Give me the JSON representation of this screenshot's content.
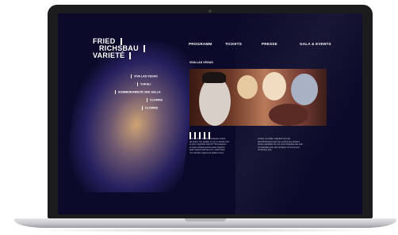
{
  "logo": {
    "line1": "FRIED",
    "line2": "RICHSBAU",
    "line3": "VARIETÉ"
  },
  "topnav": {
    "items": [
      "PROGRAMM",
      "TICKETS",
      "PRESSE",
      "GALA & EVENTS"
    ]
  },
  "subnav": {
    "items": [
      "VIVA LAS VEGAS",
      "YUKALI",
      "SOMMERVARIETÉ UND GALLA",
      "CLOWNS",
      "CLOWNS"
    ]
  },
  "main": {
    "section_label": "VIVA LAS VEGAS",
    "col1_lines": [
      "Vetrumuntin. Vet alha nonseque cusfun-",
      "dis dolod. Cur totiqdin es sel, et standiv lem",
      "ip quor magnihite sutintor? Tamquepara-",
      "et volum dolupta quinta quasi magnam,",
      "quid magnihi quid qui sum, oiebtt aspe-",
      "rum stendre magnis aut aplitia conem"
    ],
    "col2_lines": [
      "socleet. Aut dilae magnibus aut reip",
      "tatur?Perbrspert que nam ventli inucs eriiptit a",
      "donem aptitaleie erit, qui omto dolupitas essi eant",
      "vel delupitas sed, sita vel dignit. Ut pra vel est",
      "nonserspe prat."
    ]
  },
  "colors": {
    "screen_bg": "#0b0a2a",
    "text": "#ffffff",
    "laptop_frame": "#1c1c1e"
  }
}
